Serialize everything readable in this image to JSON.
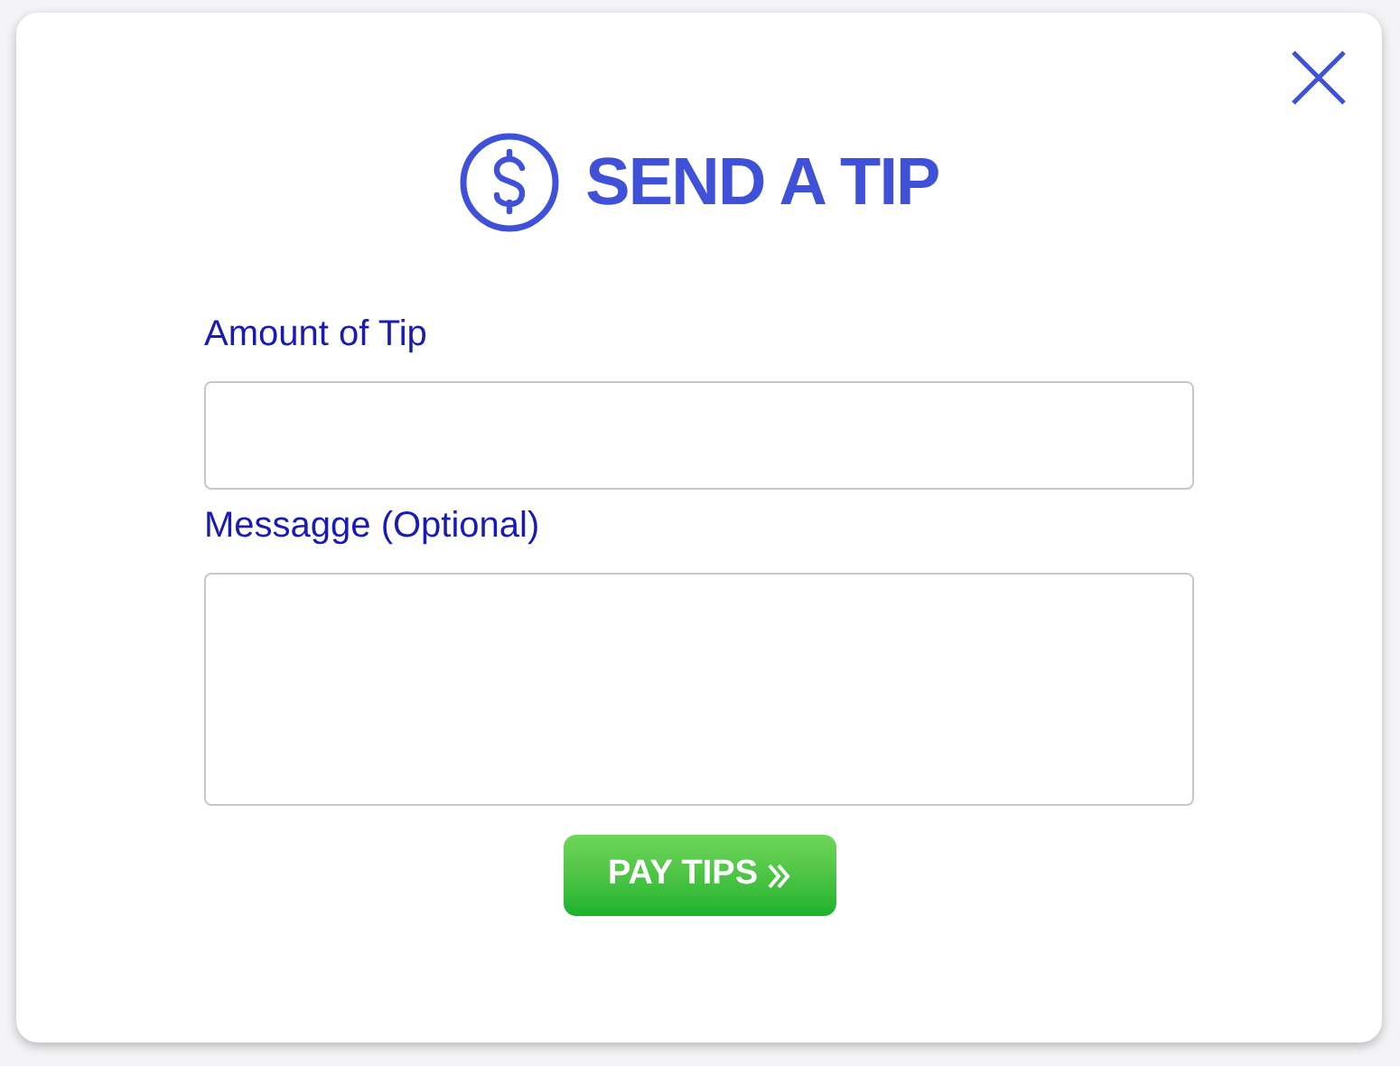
{
  "dialog": {
    "title": "SEND A TIP"
  },
  "fields": [
    {
      "label": "Amount of Tip",
      "kind": "input"
    },
    {
      "label": "Messagge (Optional)",
      "kind": "textarea"
    }
  ],
  "submit_button": {
    "label": "PAY TIPS"
  }
}
